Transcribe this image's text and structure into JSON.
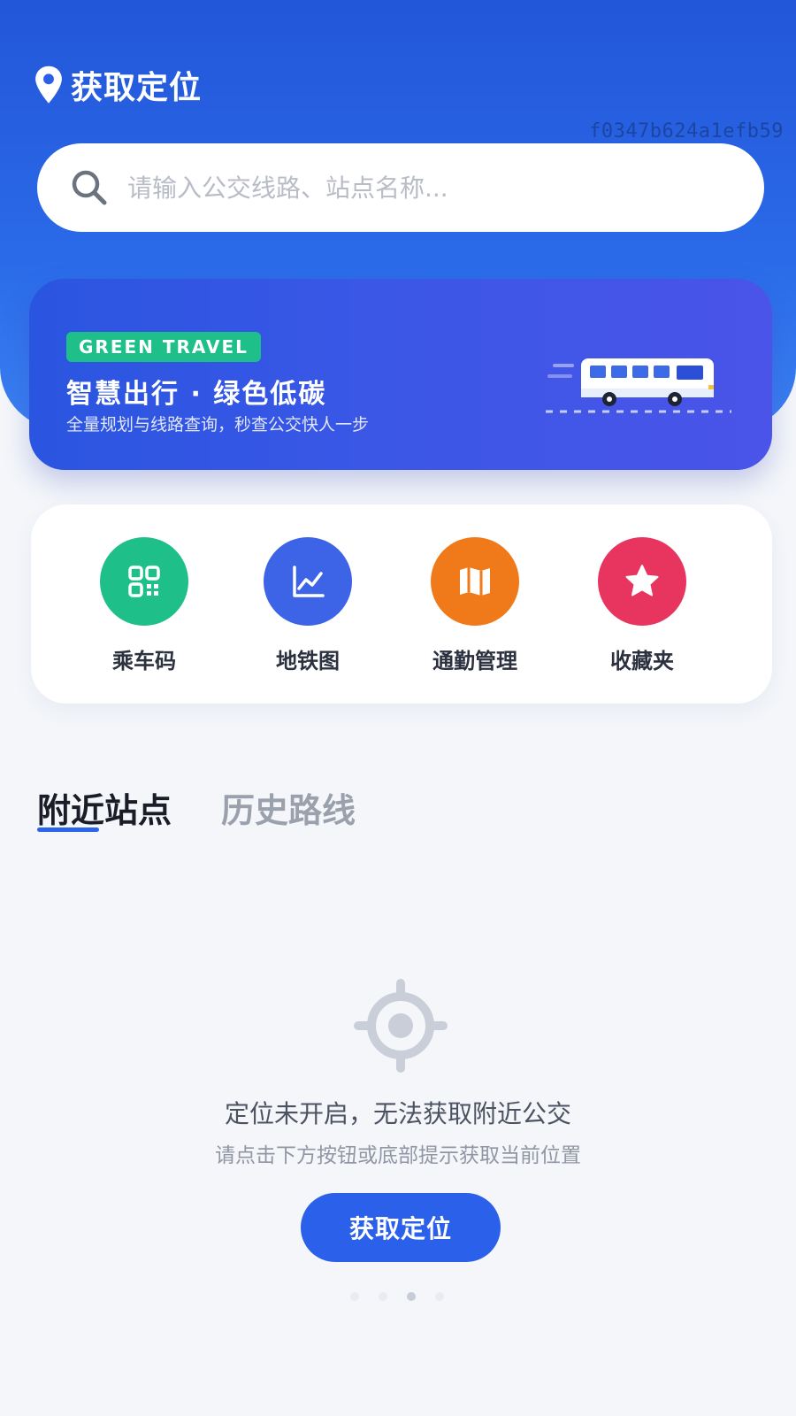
{
  "header": {
    "location_title": "获取定位",
    "debug_id": "f0347b624a1efb59"
  },
  "search": {
    "placeholder": "请输入公交线路、站点名称..."
  },
  "banner": {
    "tag": "GREEN TRAVEL",
    "title": "智慧出行 · 绿色低碳",
    "subtitle": "全量规划与线路查询，秒查公交快人一步"
  },
  "quick_actions": [
    {
      "label": "乘车码",
      "icon": "qr-code-icon",
      "color": "#1fbf8a"
    },
    {
      "label": "地铁图",
      "icon": "line-chart-icon",
      "color": "#3d63e6"
    },
    {
      "label": "通勤管理",
      "icon": "map-icon",
      "color": "#f07a1a"
    },
    {
      "label": "收藏夹",
      "icon": "star-icon",
      "color": "#e8355f"
    }
  ],
  "tabs": [
    {
      "label": "附近站点",
      "active": true
    },
    {
      "label": "历史路线",
      "active": false
    }
  ],
  "empty_state": {
    "title": "定位未开启，无法获取附近公交",
    "subtitle": "请点击下方按钮或底部提示获取当前位置",
    "button_label": "获取定位"
  },
  "colors": {
    "primary": "#2a60ea",
    "header_gradient_top": "#2356d9",
    "page_background": "#f4f6fa"
  }
}
